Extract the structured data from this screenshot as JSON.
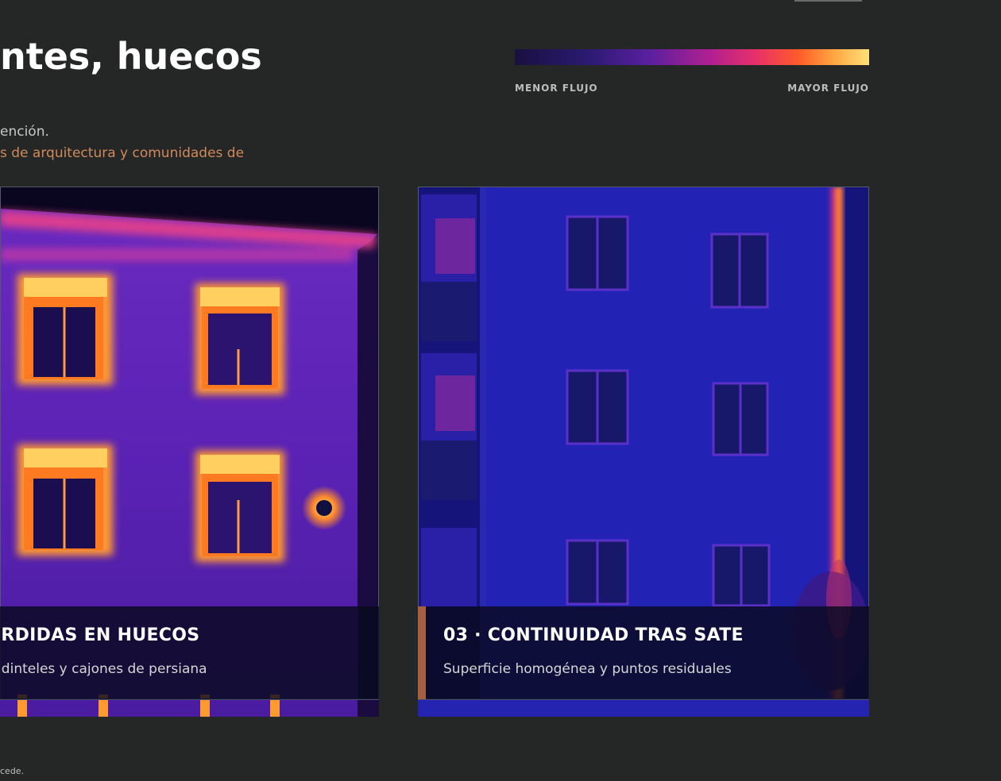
{
  "header": {
    "title": "ntes, huecos",
    "desc_line1": "ención.",
    "desc_line2": "s de arquitectura y comunidades de"
  },
  "legend": {
    "min_label": "MENOR FLUJO",
    "max_label": "MAYOR FLUJO",
    "gradient_colors": [
      "#1a1040",
      "#2a1a70",
      "#5a1fa0",
      "#b02090",
      "#e8306a",
      "#ff5a2a",
      "#ffa640",
      "#ffe07a"
    ]
  },
  "cards": [
    {
      "title": "ÉRDIDAS EN HUECOS",
      "subtitle": ". dinteles y cajones de persiana"
    },
    {
      "title": "03 · CONTINUIDAD TRAS SATE",
      "subtitle": "Superficie homogénea y puntos residuales",
      "accent_color": "#a46040"
    }
  ],
  "footer": {
    "note": "cede."
  }
}
